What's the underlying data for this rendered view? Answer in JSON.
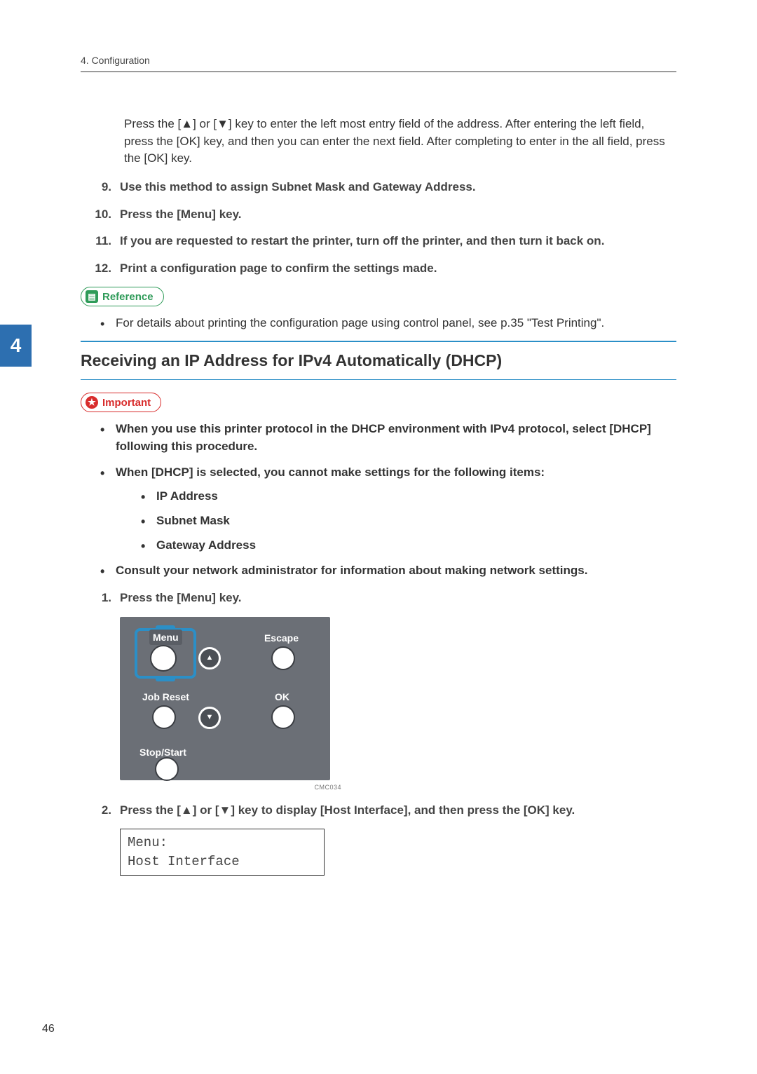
{
  "header": {
    "chapter": "4. Configuration"
  },
  "sideTab": "4",
  "intro": "Press the [▲] or [▼] key to enter the left most entry field of the address. After entering the left field, press the [OK] key, and then you can enter the next field. After completing to enter in the all field, press the [OK] key.",
  "steps1": {
    "9": {
      "num": "9.",
      "text": "Use this method to assign Subnet Mask and Gateway Address."
    },
    "10": {
      "num": "10.",
      "text": "Press the [Menu] key."
    },
    "11": {
      "num": "11.",
      "text": "If you are requested to restart the printer, turn off the printer, and then turn it back on."
    },
    "12": {
      "num": "12.",
      "text": "Print a configuration page to confirm the settings made."
    }
  },
  "referenceLabel": "Reference",
  "referenceBullet": "For details about printing the configuration page using control panel, see p.35 \"Test Printing\".",
  "sectionTitle": "Receiving an IP Address for IPv4 Automatically (DHCP)",
  "importantLabel": "Important",
  "importantBullets": {
    "b1": "When you use this printer protocol in the DHCP environment with IPv4 protocol, select [DHCP] following this procedure.",
    "b2": "When [DHCP] is selected, you cannot make settings for the following items:",
    "sub": {
      "s1": "IP Address",
      "s2": "Subnet Mask",
      "s3": "Gateway Address"
    },
    "b3": "Consult your network administrator for information about making network settings."
  },
  "steps2": {
    "1": {
      "num": "1.",
      "text": "Press the [Menu] key."
    },
    "2": {
      "num": "2.",
      "text": "Press the [▲] or [▼] key to display [Host Interface], and then press the [OK] key."
    }
  },
  "panel": {
    "menu": "Menu",
    "escape": "Escape",
    "jobReset": "Job Reset",
    "ok": "OK",
    "stopStart": "Stop/Start",
    "figId": "CMC034"
  },
  "lcd": {
    "line1": "Menu:",
    "line2": " Host Interface"
  },
  "pageNumber": "46"
}
